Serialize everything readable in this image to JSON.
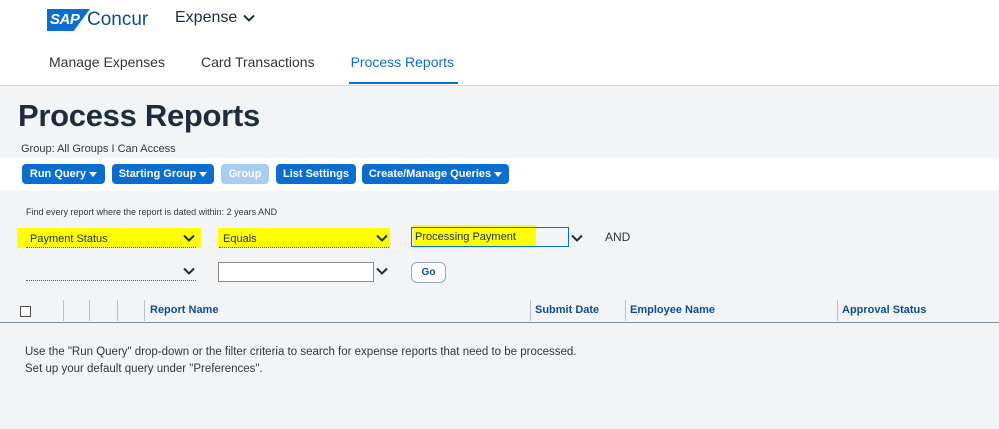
{
  "header": {
    "logo_sap": "SAP",
    "logo_concur": "Concur",
    "app_name": "Expense"
  },
  "nav": {
    "tabs": [
      {
        "label": "Manage Expenses",
        "active": false
      },
      {
        "label": "Card Transactions",
        "active": false
      },
      {
        "label": "Process Reports",
        "active": true
      }
    ]
  },
  "page": {
    "title": "Process Reports",
    "group_label": "Group: All Groups I Can Access"
  },
  "toolbar": {
    "run_query": "Run Query",
    "starting_group": "Starting Group",
    "group": "Group",
    "list_settings": "List Settings",
    "create_manage_queries": "Create/Manage Queries"
  },
  "filter": {
    "intro": "Find every report where the report is dated within: 2 years AND",
    "row1": {
      "field": "Payment Status",
      "operator": "Equals",
      "value": "Processing Payment",
      "conjunction": "AND"
    },
    "row2": {
      "field": "",
      "operator": "",
      "value": ""
    },
    "go_label": "Go"
  },
  "table": {
    "columns": [
      "Report Name",
      "Submit Date",
      "Employee Name",
      "Approval Status"
    ],
    "empty_line1": "Use the \"Run Query\" drop-down or the filter criteria to search for expense reports that need to be processed.",
    "empty_line2": "Set up your default query under \"Preferences\"."
  },
  "colors": {
    "primary": "#0a6ed1",
    "disabled": "#a9cdf0",
    "highlight": "#ffff00",
    "title": "#1d2d3e"
  }
}
